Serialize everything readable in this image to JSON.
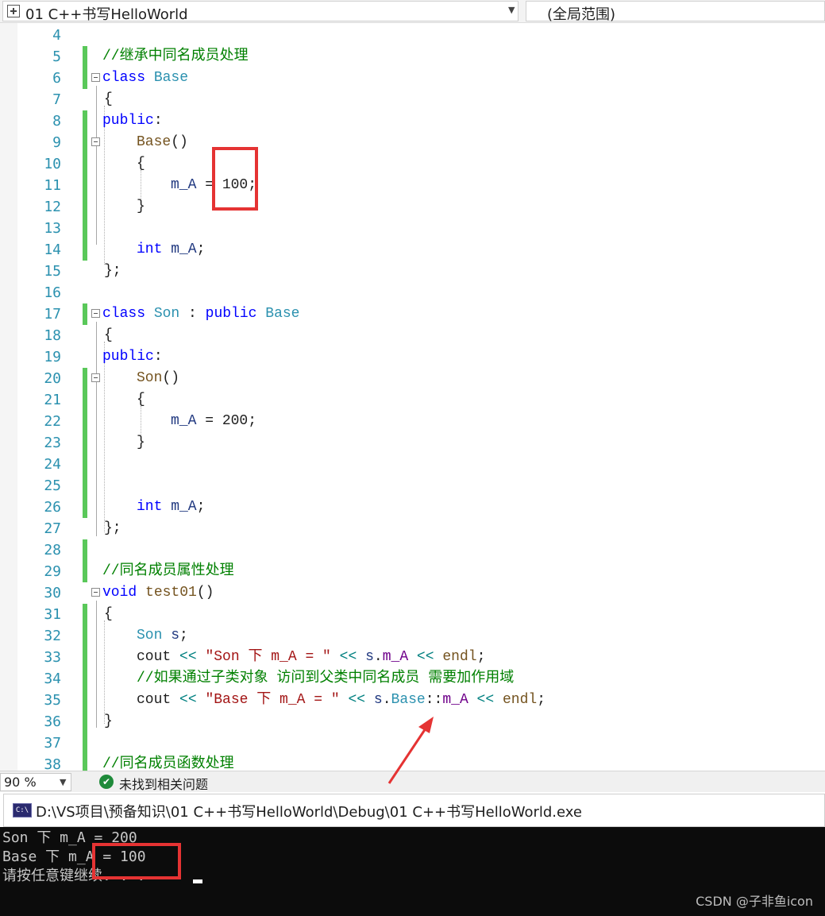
{
  "topbar": {
    "file_label": "01 C++书写HelloWorld",
    "scope_label": "(全局范围)"
  },
  "editor": {
    "lines": [
      {
        "num": "4"
      },
      {
        "num": "5",
        "comment": "//继承中同名成员处理"
      },
      {
        "num": "6",
        "kw": "class",
        "name": "Base"
      },
      {
        "num": "7",
        "text": "{"
      },
      {
        "num": "8",
        "kw": "public",
        "punct": ":"
      },
      {
        "num": "9",
        "fn": "Base",
        "punct": "()"
      },
      {
        "num": "10",
        "text": "{"
      },
      {
        "num": "11",
        "var": "m_A",
        "op": " = ",
        "val": "100",
        "end": ";"
      },
      {
        "num": "12",
        "text": "}"
      },
      {
        "num": "13"
      },
      {
        "num": "14",
        "kw": "int",
        "var": " m_A",
        "end": ";"
      },
      {
        "num": "15",
        "text": "};"
      },
      {
        "num": "16"
      },
      {
        "num": "17",
        "kw": "class",
        "name": "Son",
        "sep": " : ",
        "kw2": "public",
        "base": "Base"
      },
      {
        "num": "18",
        "text": "{"
      },
      {
        "num": "19",
        "kw": "public",
        "punct": ":"
      },
      {
        "num": "20",
        "fn": "Son",
        "punct": "()"
      },
      {
        "num": "21",
        "text": "{"
      },
      {
        "num": "22",
        "var": "m_A",
        "op": " = ",
        "val": "200",
        "end": ";"
      },
      {
        "num": "23",
        "text": "}"
      },
      {
        "num": "24"
      },
      {
        "num": "25"
      },
      {
        "num": "26",
        "kw": "int",
        "var": " m_A",
        "end": ";"
      },
      {
        "num": "27",
        "text": "};"
      },
      {
        "num": "28"
      },
      {
        "num": "29",
        "comment": "//同名成员属性处理"
      },
      {
        "num": "30",
        "kw": "void",
        "fn": "test01",
        "punct": "()"
      },
      {
        "num": "31",
        "text": "{"
      },
      {
        "num": "32",
        "type": "Son",
        "var": " s",
        "end": ";"
      },
      {
        "num": "33",
        "cout": "cout",
        "op1": " << ",
        "str": "\"Son 下 m_A = \"",
        "op2": " << ",
        "obj": "s",
        "dot": ".",
        "mem": "m_A",
        "op3": " << ",
        "endl": "endl",
        "end": ";"
      },
      {
        "num": "34",
        "comment": "//如果通过子类对象 访问到父类中同名成员 需要加作用域"
      },
      {
        "num": "35",
        "cout": "cout",
        "op1": " << ",
        "str": "\"Base 下 m_A = \"",
        "op2": " << ",
        "obj": "s",
        "dot": ".",
        "scope": "Base",
        "colons": "::",
        "mem": "m_A",
        "op3": " << ",
        "endl": "endl",
        "end": ";"
      },
      {
        "num": "36",
        "text": "}"
      },
      {
        "num": "37"
      },
      {
        "num": "38",
        "comment": "//同名成员函数处理"
      }
    ]
  },
  "statusbar": {
    "zoom": "90 %",
    "issues": "未找到相关问题"
  },
  "console": {
    "path": "D:\\VS项目\\预备知识\\01 C++书写HelloWorld\\Debug\\01 C++书写HelloWorld.exe",
    "icon_text": "C:\\",
    "lines": [
      "Son 下 m_A = 200",
      "Base 下 m_A = 100",
      "请按任意键继续. . ."
    ],
    "watermark": "CSDN @子非鱼icon"
  },
  "colors": {
    "keyword": "#0000ff",
    "type": "#2b91af",
    "comment": "#008000",
    "string": "#a31515",
    "change_bar": "#5ac85a",
    "highlight": "#e53333"
  }
}
